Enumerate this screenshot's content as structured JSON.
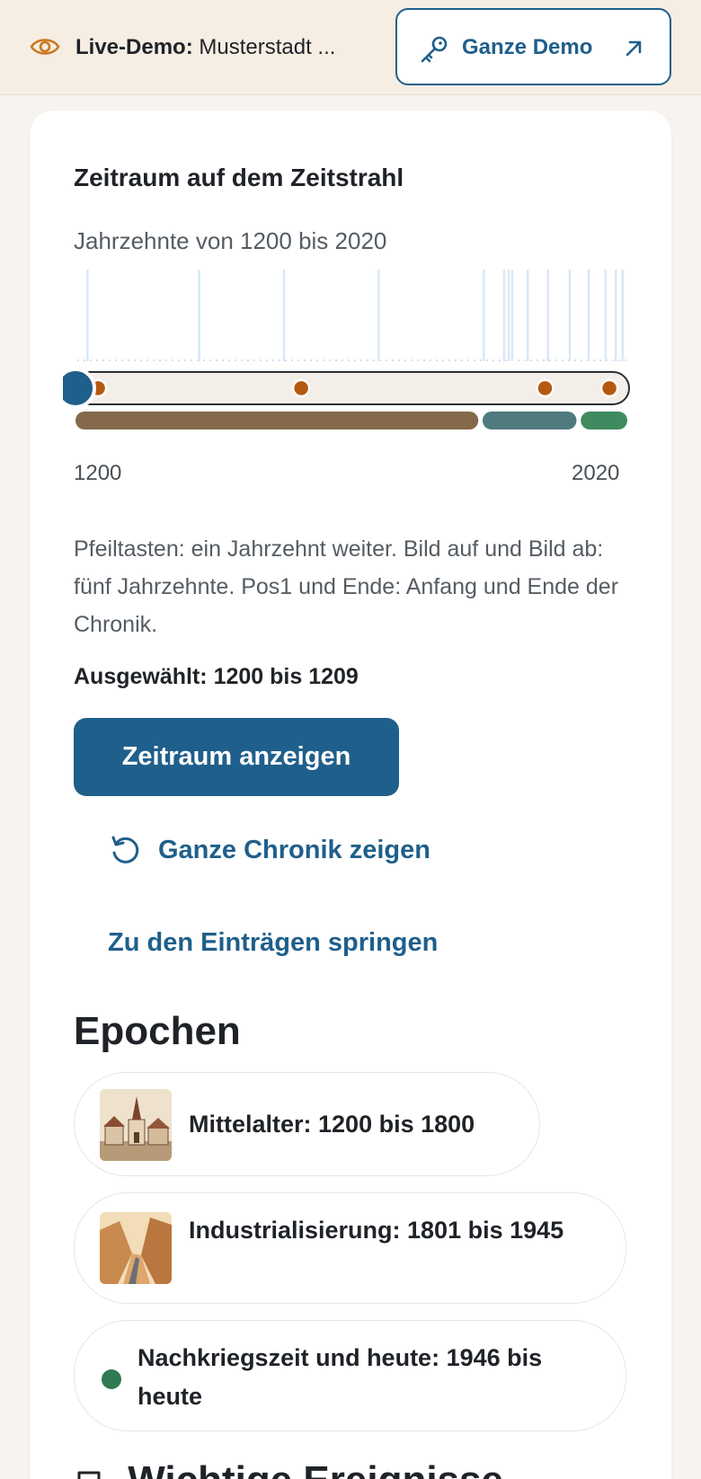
{
  "banner": {
    "icon": "eye-icon",
    "label_bold": "Live-Demo:",
    "label_text": "Musterstadt ...",
    "demo_button": {
      "label": "Ganze Demo",
      "icon": "key-icon",
      "arrow_icon": "arrow-up-right-icon"
    }
  },
  "timeline_section": {
    "title": "Zeitraum auf dem Zeitstrahl",
    "subtitle": "Jahrzehnte von 1200 bis 2020",
    "axis_start": "1200",
    "axis_end": "2020",
    "help_text": "Pfeiltasten: ein Jahrzehnt weiter. Bild auf und Bild ab: fünf Jahrzehnte. Pos1 und Ende: Anfang und Ende der Chronik.",
    "selected_label": "Ausgewählt: 1200 bis 1209",
    "show_button": "Zeitraum anzeigen",
    "reset_button": "Ganze Chronik zeigen",
    "jump_link": "Zu den Einträgen springen"
  },
  "timeline": {
    "range": [
      1200,
      2020
    ],
    "selected_start": 1200,
    "event_years": [
      1220,
      1385,
      1510,
      1650,
      1805,
      1835,
      1842,
      1847,
      1870,
      1900,
      1932,
      1960,
      1985,
      2000,
      2010
    ],
    "marker_years": [
      1220,
      1520,
      1880,
      1975
    ],
    "epoch_bands": [
      {
        "start": 1200,
        "end": 1800,
        "color": "#85694b"
      },
      {
        "start": 1801,
        "end": 1945,
        "color": "#4f7a7e"
      },
      {
        "start": 1946,
        "end": 2020,
        "color": "#3f8b5f"
      }
    ],
    "colors": {
      "track": "#f3efe8",
      "marker": "#b4590f",
      "handle": "#1f5f8b",
      "event_line": "#dbe8f5"
    }
  },
  "epochs": {
    "title": "Epochen",
    "items": [
      {
        "label": "Mittelalter: 1200 bis 1800",
        "thumb": "medieval-town-image"
      },
      {
        "label": "Industrialisierung: 1801 bis 1945",
        "thumb": "valley-road-image"
      },
      {
        "label": "Nachkriegszeit und heute: 1946 bis heute",
        "dot_color": "#2e7a52"
      }
    ]
  },
  "next_section": {
    "title": "Wichtige Ereignisse",
    "icon": "bookmark-icon"
  }
}
